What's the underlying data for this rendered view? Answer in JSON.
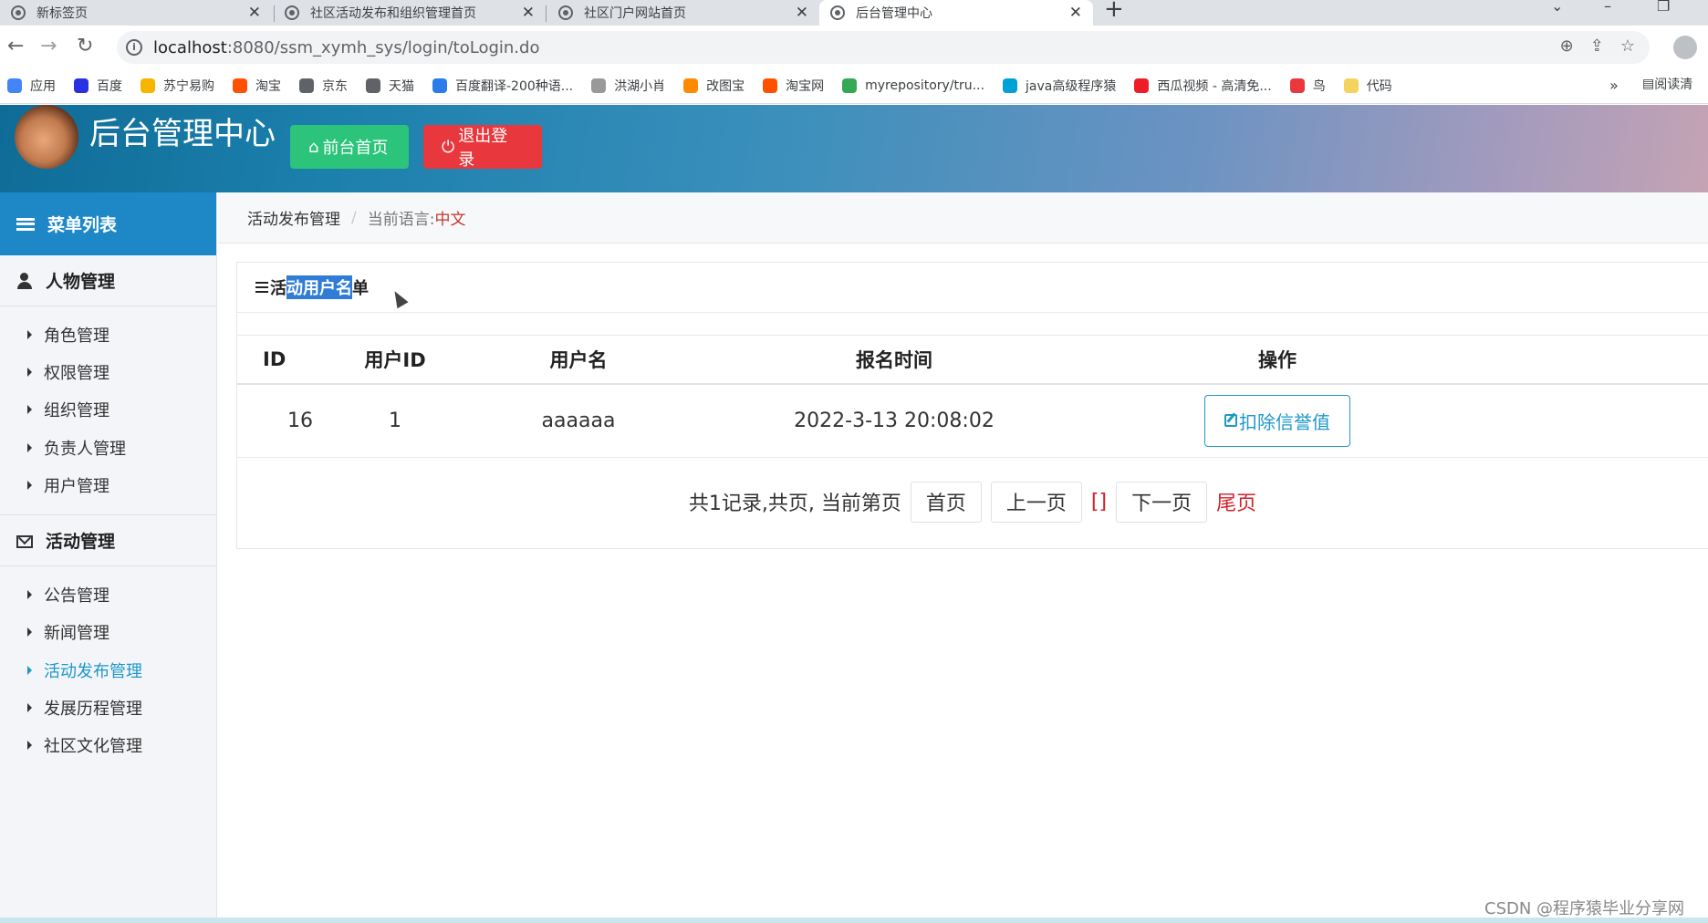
{
  "browser": {
    "tabs": [
      {
        "title": "新标签页",
        "active": false
      },
      {
        "title": "社区活动发布和组织管理首页",
        "active": false
      },
      {
        "title": "社区门户网站首页",
        "active": false
      },
      {
        "title": "后台管理中心",
        "active": true
      }
    ],
    "url_host": "localhost",
    "url_path": ":8080/ssm_xymh_sys/login/toLogin.do",
    "bookmarks": [
      {
        "label": "应用",
        "color": "#4285f4"
      },
      {
        "label": "百度",
        "color": "#2932e1"
      },
      {
        "label": "苏宁易购",
        "color": "#f7b500"
      },
      {
        "label": "淘宝",
        "color": "#ff5000"
      },
      {
        "label": "京东",
        "color": "#5f6368"
      },
      {
        "label": "天猫",
        "color": "#5f6368"
      },
      {
        "label": "百度翻译-200种语...",
        "color": "#2b7ce9"
      },
      {
        "label": "洪湖小肖",
        "color": "#999999"
      },
      {
        "label": "改图宝",
        "color": "#ff8a00"
      },
      {
        "label": "淘宝网",
        "color": "#ff5000"
      },
      {
        "label": "myrepository/tru...",
        "color": "#34a853"
      },
      {
        "label": "java高级程序猿",
        "color": "#00a1d6"
      },
      {
        "label": "西瓜视频 - 高清免...",
        "color": "#ee1c25"
      },
      {
        "label": "鸟",
        "color": "#e8383d"
      },
      {
        "label": "代码",
        "color": "#f4d35e"
      }
    ],
    "more": "»",
    "reading": "阅读清"
  },
  "header": {
    "title": "后台管理中心",
    "home_button": "前台首页",
    "logout_button": "退出登录"
  },
  "sidebar": {
    "menu_title": "菜单列表",
    "groups": [
      {
        "title": "人物管理",
        "items": [
          "角色管理",
          "权限管理",
          "组织管理",
          "负责人管理",
          "用户管理"
        ]
      },
      {
        "title": "活动管理",
        "items": [
          "公告管理",
          "新闻管理",
          "活动发布管理",
          "发展历程管理",
          "社区文化管理"
        ]
      }
    ],
    "active_item": "活动发布管理"
  },
  "breadcrumb": {
    "section": "活动发布管理",
    "separator": "/",
    "lang_label": "当前语言:",
    "lang_value": "中文"
  },
  "panel": {
    "title_prefix": "活",
    "title_highlight": "动用户名",
    "title_suffix": "单"
  },
  "table": {
    "columns": [
      "ID",
      "用户ID",
      "用户名",
      "报名时间",
      "操作"
    ],
    "rows": [
      {
        "id": "16",
        "user_id": "1",
        "username": "aaaaaa",
        "time": "2022-3-13 20:08:02",
        "action": "扣除信誉值"
      }
    ]
  },
  "pager": {
    "info": "共1记录,共页, 当前第页",
    "first": "首页",
    "prev": "上一页",
    "current": "[]",
    "next": "下一页",
    "last": "尾页"
  },
  "watermark": "CSDN @程序猿毕业分享网",
  "colors": {
    "accent": "#1e98c9",
    "home_button": "#2bc47a",
    "logout_button": "#e8383d",
    "pager_red": "#d0212b"
  }
}
